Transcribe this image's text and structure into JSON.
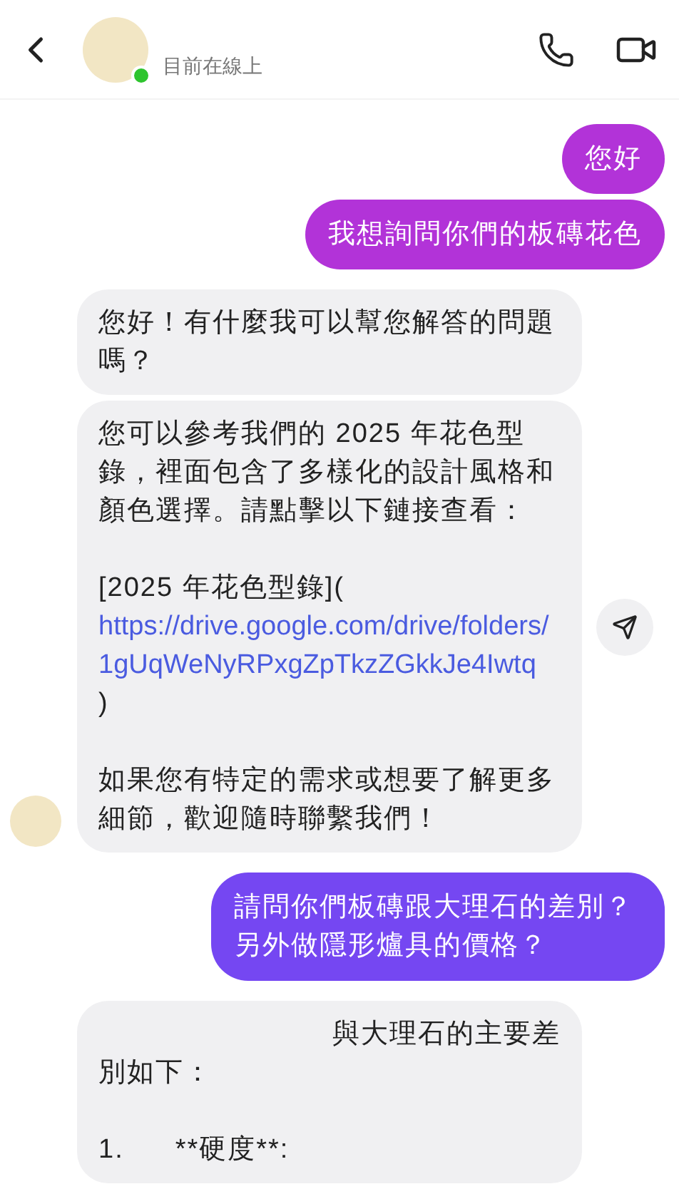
{
  "header": {
    "status": "目前在線上",
    "online": true
  },
  "messages": [
    {
      "kind": "sent",
      "color": "#b233d8",
      "paragraphs": [
        {
          "kind": "plain",
          "parts": [
            {
              "kind": "text",
              "text": "您好"
            }
          ]
        }
      ]
    },
    {
      "kind": "sent",
      "color": "#b233d8",
      "paragraphs": [
        {
          "kind": "plain",
          "parts": [
            {
              "kind": "text",
              "text": "我想詢問你們的板磚花色"
            }
          ]
        }
      ]
    },
    {
      "kind": "received",
      "avatar": false,
      "share": false,
      "paragraphs": [
        {
          "kind": "plain",
          "parts": [
            {
              "kind": "text",
              "text": "您好！有什麼我可以幫您解答的問題嗎？"
            }
          ]
        }
      ]
    },
    {
      "kind": "received",
      "avatar": true,
      "share": true,
      "paragraphs": [
        {
          "kind": "plain",
          "parts": [
            {
              "kind": "text",
              "text": "您可以參考我們的 2025 年花色型錄，裡面包含了多樣化的設計風格和顏色選擇。請點擊以下鏈接查看："
            }
          ]
        },
        {
          "kind": "plain",
          "parts": [
            {
              "kind": "text",
              "text": "[2025 年花色型錄]("
            },
            {
              "kind": "link",
              "text": "https://drive.google.com/drive/folders/1gUqWeNyRPxgZpTkzZGkkJe4Iwtq"
            },
            {
              "kind": "text",
              "text": ")"
            }
          ]
        },
        {
          "kind": "plain",
          "parts": [
            {
              "kind": "text",
              "text": "如果您有特定的需求或想要了解更多細節，歡迎隨時聯繫我們！"
            }
          ]
        }
      ]
    },
    {
      "kind": "sent",
      "color": "#7547f2",
      "paragraphs": [
        {
          "kind": "plain",
          "parts": [
            {
              "kind": "text",
              "text": "請問你們板磚跟大理石的差別？另外做隱形爐具的價格？"
            }
          ]
        }
      ]
    },
    {
      "kind": "received",
      "avatar": false,
      "share": false,
      "paragraphs": [
        {
          "kind": "indented",
          "parts": [
            {
              "kind": "text",
              "text": "與大理石的主要差"
            }
          ]
        },
        {
          "kind": "line",
          "parts": [
            {
              "kind": "text",
              "text": "別如下："
            }
          ]
        },
        {
          "kind": "plain",
          "parts": [
            {
              "kind": "text",
              "text": "1."
            },
            {
              "kind": "text",
              "text": "**硬度**:"
            }
          ]
        }
      ]
    }
  ]
}
